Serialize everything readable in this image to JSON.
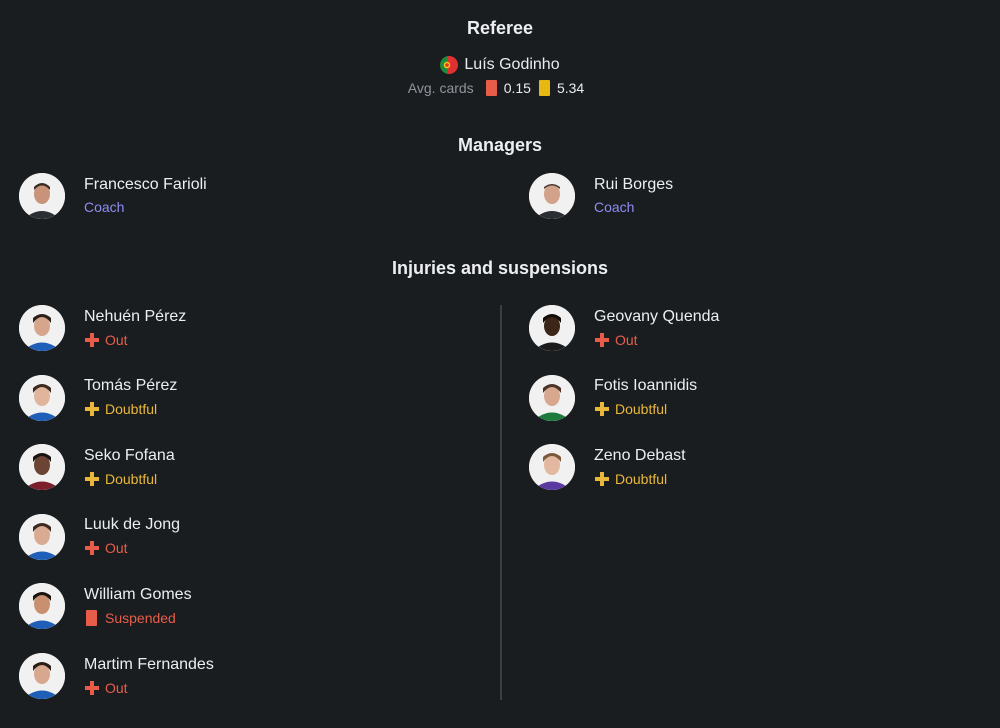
{
  "referee": {
    "title": "Referee",
    "name": "Luís Godinho",
    "avg_label": "Avg. cards",
    "red_avg": "0.15",
    "yellow_avg": "5.34",
    "colors": {
      "red": "#e85d4a",
      "yellow": "#e7b712"
    }
  },
  "managers": {
    "title": "Managers",
    "home": {
      "name": "Francesco Farioli",
      "role": "Coach"
    },
    "away": {
      "name": "Rui Borges",
      "role": "Coach"
    }
  },
  "injuries": {
    "title": "Injuries and suspensions",
    "home": [
      {
        "name": "Nehuén Pérez",
        "status": "Out",
        "type": "out"
      },
      {
        "name": "Tomás Pérez",
        "status": "Doubtful",
        "type": "doubtful"
      },
      {
        "name": "Seko Fofana",
        "status": "Doubtful",
        "type": "doubtful"
      },
      {
        "name": "Luuk de Jong",
        "status": "Out",
        "type": "out"
      },
      {
        "name": "William Gomes",
        "status": "Suspended",
        "type": "suspended"
      },
      {
        "name": "Martim Fernandes",
        "status": "Out",
        "type": "out"
      }
    ],
    "away": [
      {
        "name": "Geovany Quenda",
        "status": "Out",
        "type": "out"
      },
      {
        "name": "Fotis Ioannidis",
        "status": "Doubtful",
        "type": "doubtful"
      },
      {
        "name": "Zeno Debast",
        "status": "Doubtful",
        "type": "doubtful"
      }
    ]
  },
  "colors": {
    "background": "#1a1d20",
    "coach": "#8f8cf2",
    "out": "#e85d4a",
    "doubtful": "#e9b83a"
  }
}
